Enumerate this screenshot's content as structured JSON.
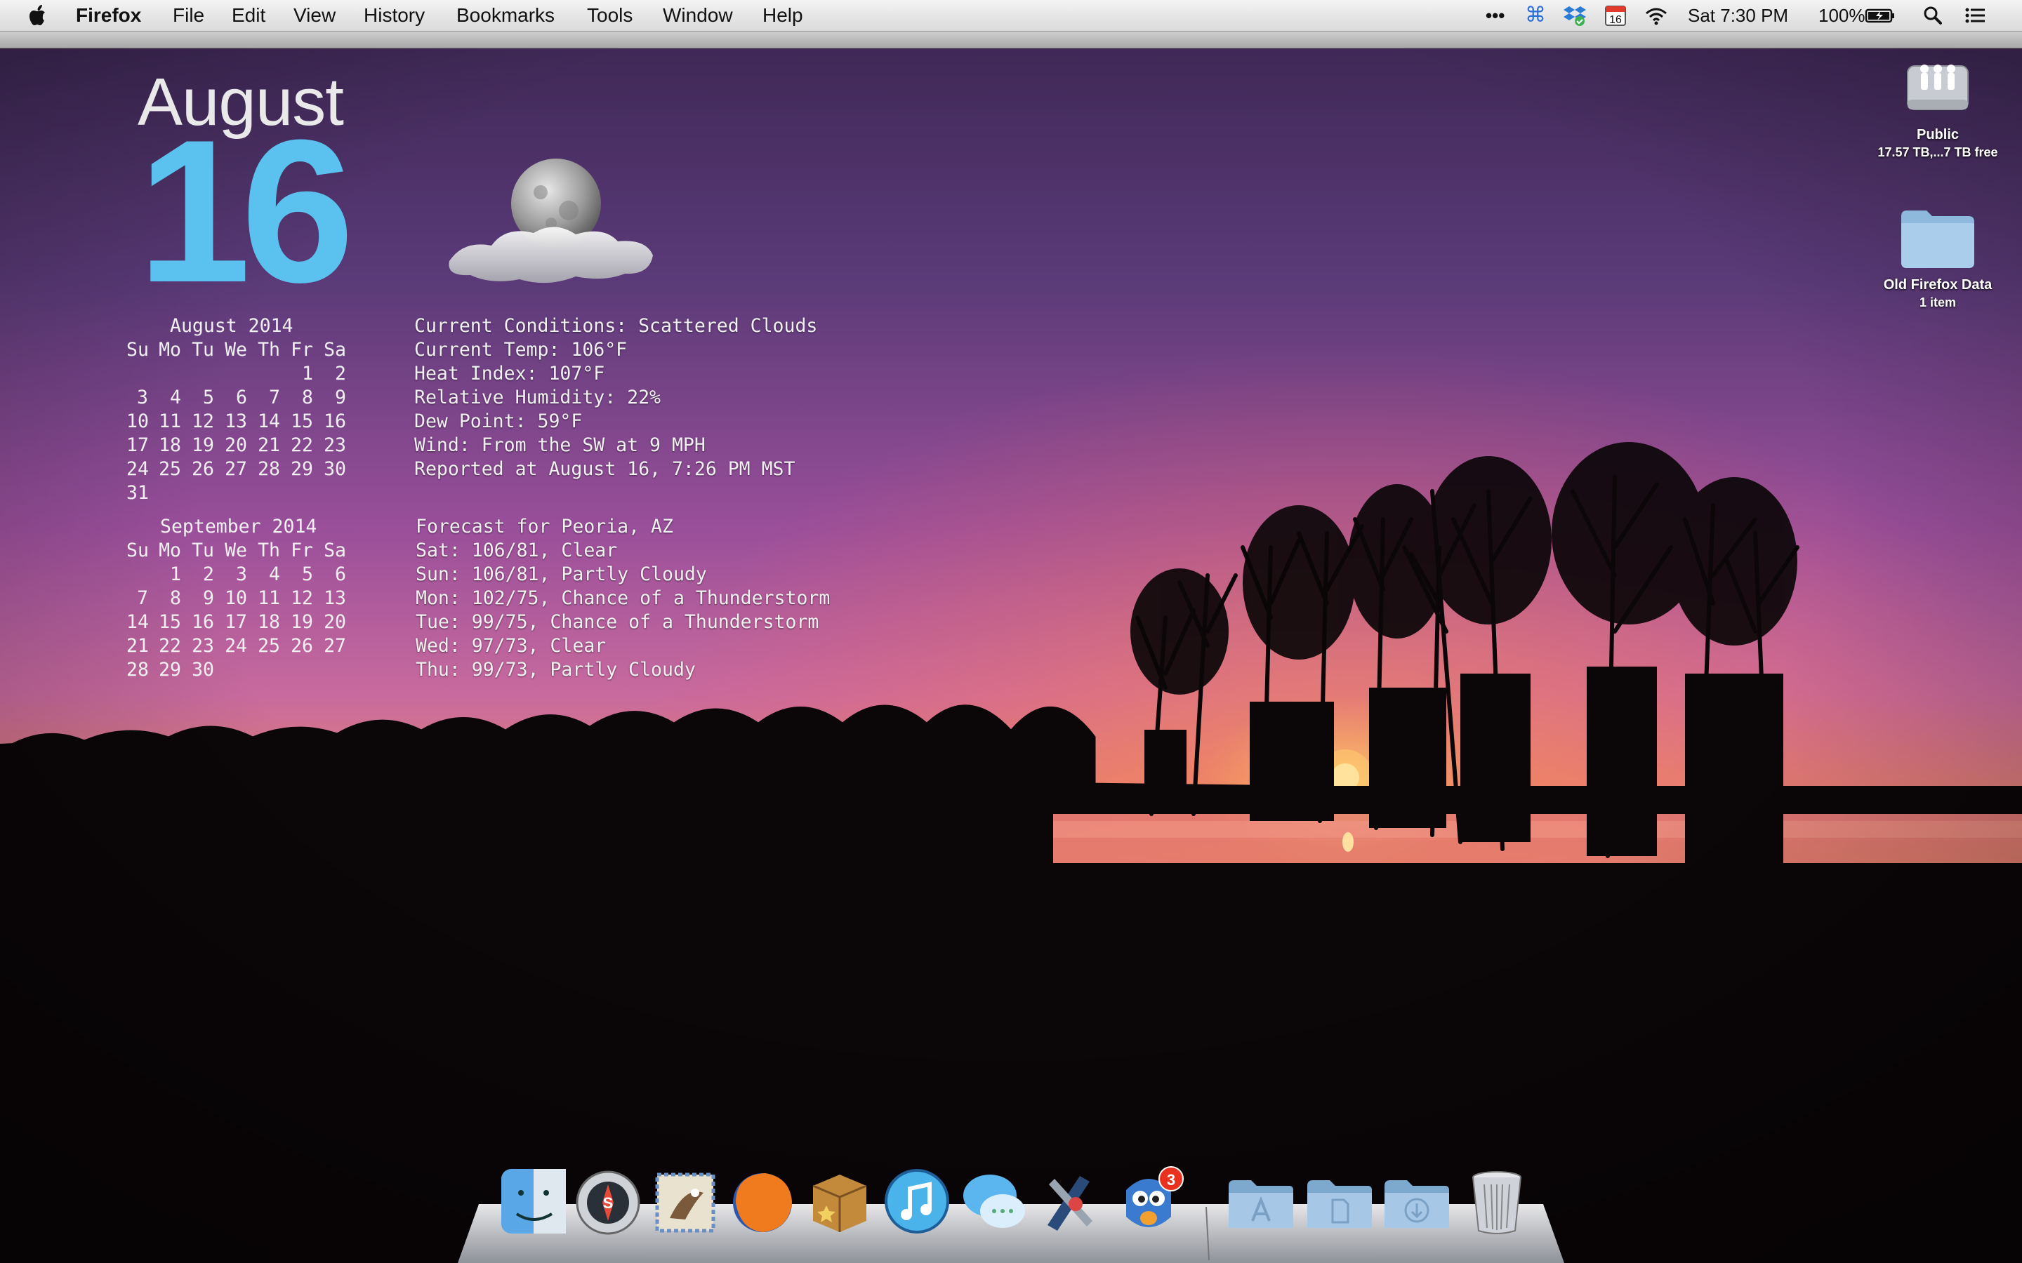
{
  "menubar": {
    "app_name": "Firefox",
    "menus": [
      "File",
      "Edit",
      "View",
      "History",
      "Bookmarks",
      "Tools",
      "Window",
      "Help"
    ],
    "status": {
      "dots": "•••",
      "cmd": "⌘",
      "calendar_day": "16",
      "clock": "Sat 7:30 PM",
      "battery": "100%"
    }
  },
  "desktop_icons": [
    {
      "label": "Public",
      "sub": "17.57 TB,...7 TB free"
    },
    {
      "label": "Old Firefox Data",
      "sub": "1 item"
    }
  ],
  "date_widget": {
    "month": "August",
    "day": "16"
  },
  "calendars": [
    {
      "title": "August 2014",
      "weekdays": [
        "Su",
        "Mo",
        "Tu",
        "We",
        "Th",
        "Fr",
        "Sa"
      ],
      "weeks": [
        [
          "",
          "",
          "",
          "",
          "",
          "1",
          "2"
        ],
        [
          "3",
          "4",
          "5",
          "6",
          "7",
          "8",
          "9"
        ],
        [
          "10",
          "11",
          "12",
          "13",
          "14",
          "15",
          "16"
        ],
        [
          "17",
          "18",
          "19",
          "20",
          "21",
          "22",
          "23"
        ],
        [
          "24",
          "25",
          "26",
          "27",
          "28",
          "29",
          "30"
        ],
        [
          "31",
          "",
          "",
          "",
          "",
          "",
          ""
        ]
      ]
    },
    {
      "title": "September 2014",
      "weekdays": [
        "Su",
        "Mo",
        "Tu",
        "We",
        "Th",
        "Fr",
        "Sa"
      ],
      "weeks": [
        [
          "",
          "1",
          "2",
          "3",
          "4",
          "5",
          "6"
        ],
        [
          "7",
          "8",
          "9",
          "10",
          "11",
          "12",
          "13"
        ],
        [
          "14",
          "15",
          "16",
          "17",
          "18",
          "19",
          "20"
        ],
        [
          "21",
          "22",
          "23",
          "24",
          "25",
          "26",
          "27"
        ],
        [
          "28",
          "29",
          "30",
          "",
          "",
          "",
          ""
        ]
      ]
    }
  ],
  "weather": {
    "conditions": [
      "Current Conditions: Scattered Clouds",
      "Current Temp: 106°F",
      "Heat Index: 107°F",
      "Relative Humidity: 22%",
      "Dew Point: 59°F",
      "Wind: From the SW at 9 MPH",
      "Reported at August 16, 7:26 PM MST"
    ],
    "forecast": [
      "Forecast for Peoria, AZ",
      "Sat: 106/81, Clear",
      "Sun: 106/81, Partly Cloudy",
      "Mon: 102/75, Chance of a Thunderstorm",
      "Tue: 99/75, Chance of a Thunderstorm",
      "Wed: 97/73, Clear",
      "Thu: 99/73, Partly Cloudy"
    ]
  },
  "dock": {
    "apps": [
      "finder-icon",
      "path-finder-icon",
      "mail-icon",
      "firefox-icon",
      "delicious-library-icon",
      "itunes-icon",
      "messages-icon",
      "xcode-instruments-icon",
      "tweetbot-icon"
    ],
    "folders": [
      "applications-folder-icon",
      "documents-folder-icon",
      "downloads-folder-icon"
    ],
    "trash": "trash-icon",
    "tweetbot_badge": "3"
  },
  "colors": {
    "accent_day": "#5bc1ee",
    "badge": "#e8321f"
  }
}
